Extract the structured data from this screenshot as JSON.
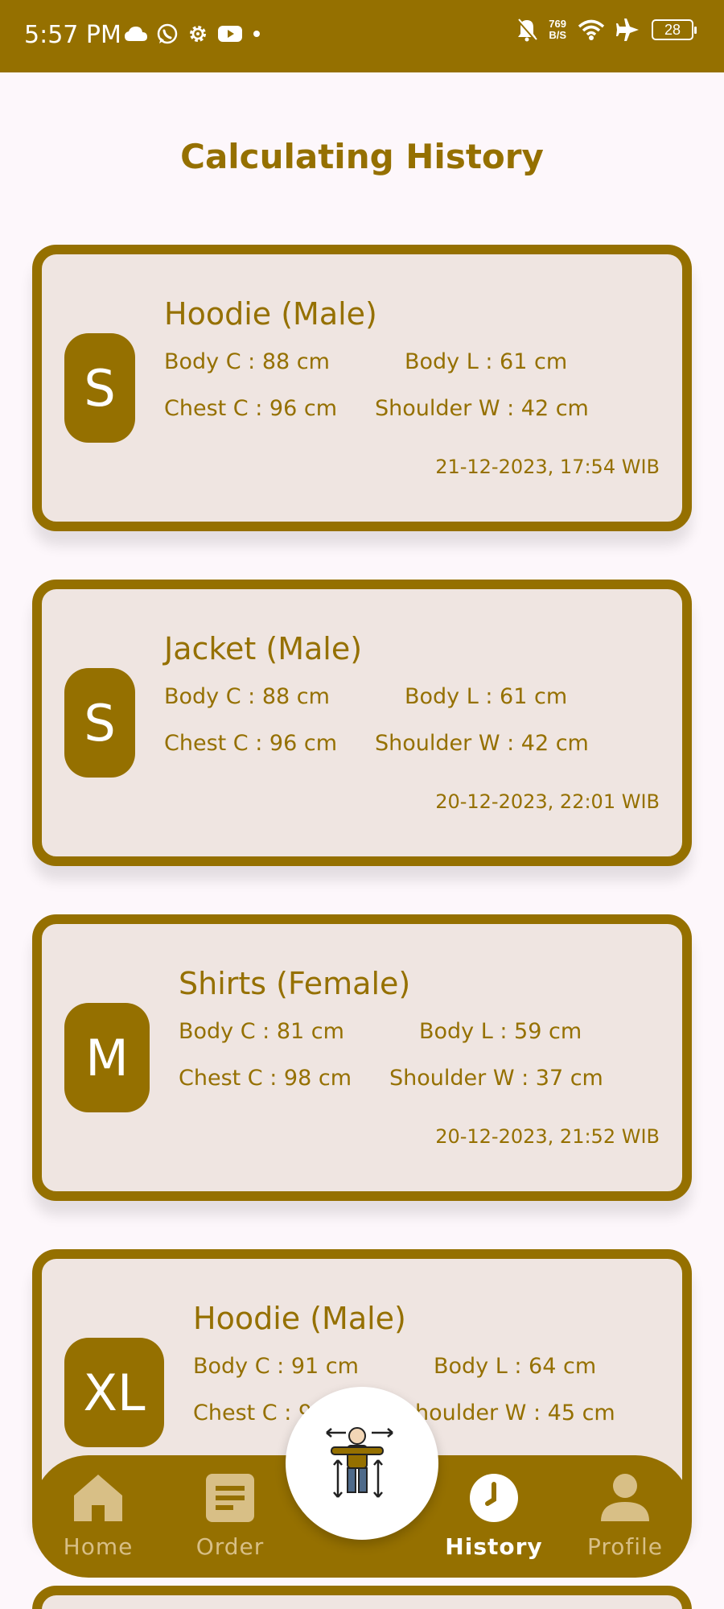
{
  "status_bar": {
    "time": "5:57 PM",
    "speed_value": "769",
    "speed_unit": "B/S",
    "battery": "28",
    "icons_left": [
      "cloud-icon",
      "whatsapp-icon",
      "settings-icon",
      "youtube-icon",
      "dot-icon"
    ],
    "icons_right": [
      "bell-off-icon",
      "wifi-icon",
      "airplane-icon",
      "battery-icon"
    ]
  },
  "page": {
    "title": "Calculating History"
  },
  "history": [
    {
      "size": "S",
      "item": "Hoodie (Male)",
      "body_c": "Body C : 88 cm",
      "body_l": "Body L : 61 cm",
      "chest_c": "Chest C : 96 cm",
      "shoulder_w": "Shoulder W : 42 cm",
      "timestamp": "21-12-2023, 17:54 WIB"
    },
    {
      "size": "S",
      "item": "Jacket (Male)",
      "body_c": "Body C : 88 cm",
      "body_l": "Body L : 61 cm",
      "chest_c": "Chest C : 96 cm",
      "shoulder_w": "Shoulder W : 42 cm",
      "timestamp": "20-12-2023, 22:01 WIB"
    },
    {
      "size": "M",
      "item": "Shirts (Female)",
      "body_c": "Body C : 81 cm",
      "body_l": "Body L : 59 cm",
      "chest_c": "Chest C : 98 cm",
      "shoulder_w": "Shoulder W : 37 cm",
      "timestamp": "20-12-2023, 21:52 WIB"
    },
    {
      "size": "XL",
      "item": "Hoodie (Male)",
      "body_c": "Body C : 91 cm",
      "body_l": "Body L : 64 cm",
      "chest_c": "Chest C : 9",
      "shoulder_w": "houlder W : 45 cm"
    }
  ],
  "nav": {
    "home": "Home",
    "order": "Order",
    "history": "History",
    "profile": "Profile",
    "active": "history"
  },
  "colors": {
    "brand": "#957000",
    "card_bg": "#efe5e1",
    "page_bg": "#fdf7fb",
    "nav_inactive": "#d8bf86"
  }
}
